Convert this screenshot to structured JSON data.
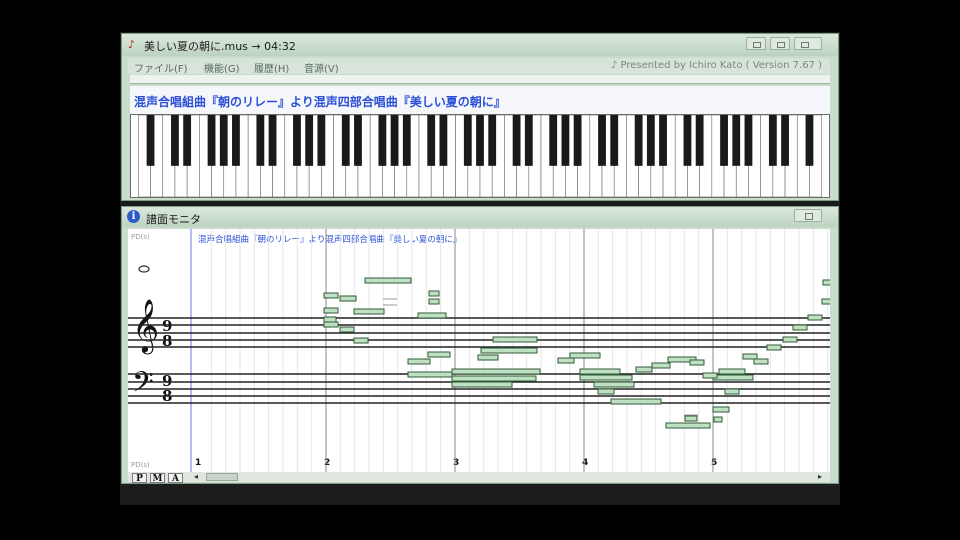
{
  "window_main": {
    "title": "美しい夏の朝に.mus → 04:32",
    "menus": [
      "ファイル(F)",
      "機能(G)",
      "履歴(H)",
      "音源(V)"
    ],
    "presented_by": "♪ Presented by Ichiro Kato ( Version 7.67 )",
    "song_title": "混声合唱組曲『朝のリレー』より混声四部合唱曲『美しい夏の朝に』"
  },
  "window_monitor": {
    "title": "譜面モニタ",
    "score_title": "混声合唱組曲『朝のリレー』より混声四部合唱曲『美しい夏の朝に』",
    "time_signature": {
      "numerator": "9",
      "denominator": "8"
    },
    "measure_numbers": [
      "1",
      "2",
      "3",
      "4",
      "5"
    ],
    "top_left_label": "PD(s)",
    "bottom_left_label": "PD(s)",
    "track_buttons": [
      "P",
      "M",
      "A"
    ]
  },
  "icons": {
    "app": "music-note-icon",
    "monitor": "info-icon",
    "treble": "treble-clef-icon",
    "bass": "bass-clef-icon",
    "whole_note": "whole-note-icon"
  },
  "colors": {
    "window_frame": "#c9dccb",
    "title_text": "#2a4fd8",
    "note_fill": "#bfe0c2",
    "note_stroke": "#2f5a35"
  }
}
